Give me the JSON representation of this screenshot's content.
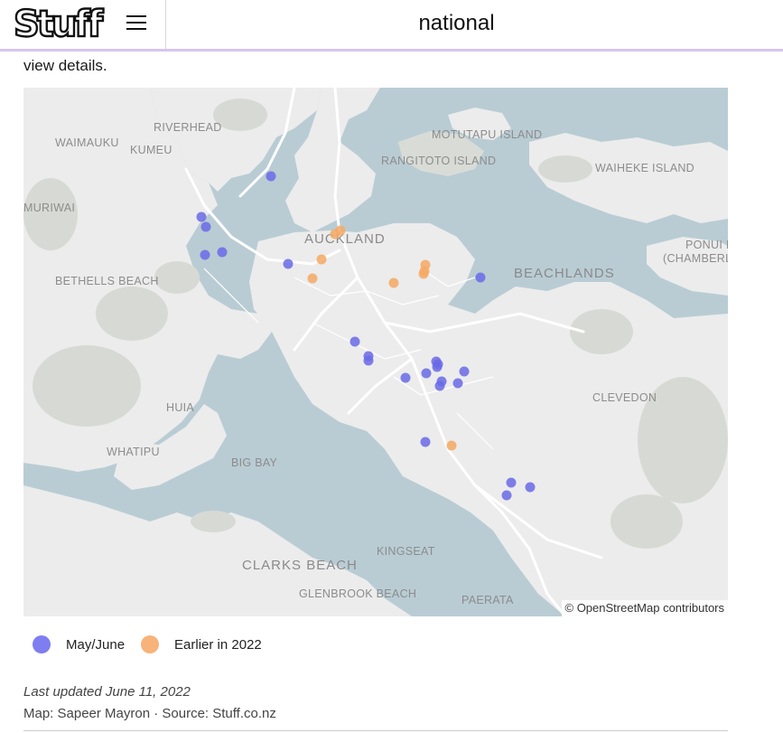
{
  "header": {
    "logo": "Stuff",
    "section": "national"
  },
  "intro_text": "view details.",
  "map": {
    "attribution": "© OpenStreetMap contributors",
    "colors": {
      "water": "#b9ccd4",
      "land": "#f0f0f0",
      "park": "#d6d9d4",
      "road": "#ffffff",
      "may_june": "#6a6ae8",
      "earlier": "#f5a964"
    },
    "place_labels": [
      {
        "id": "riverhead",
        "text": "RIVERHEAD"
      },
      {
        "id": "waimauku",
        "text": "WAIMAUKU"
      },
      {
        "id": "kumeu",
        "text": "KUMEU"
      },
      {
        "id": "motutapu",
        "text": "MOTUTAPU ISLAND"
      },
      {
        "id": "rangitoto",
        "text": "RANGITOTO ISLAND"
      },
      {
        "id": "waiheke",
        "text": "WAIHEKE ISLAND"
      },
      {
        "id": "muriwai",
        "text": "MURIWAI"
      },
      {
        "id": "auckland",
        "text": "AUCKLAND"
      },
      {
        "id": "ponui1",
        "text": "PONUI IS"
      },
      {
        "id": "ponui2",
        "text": "(CHAMBERLIN"
      },
      {
        "id": "beachlands",
        "text": "BEACHLANDS"
      },
      {
        "id": "bethells",
        "text": "BETHELLS BEACH"
      },
      {
        "id": "clevedon",
        "text": "CLEVEDON"
      },
      {
        "id": "huia",
        "text": "HUIA"
      },
      {
        "id": "whatipu",
        "text": "WHATIPU"
      },
      {
        "id": "bigbay",
        "text": "BIG BAY"
      },
      {
        "id": "kingseat",
        "text": "KINGSEAT"
      },
      {
        "id": "clarks",
        "text": "CLARKS BEACH"
      },
      {
        "id": "glenbrook",
        "text": "GLENBROOK BEACH"
      },
      {
        "id": "paerata",
        "text": "PAERATA"
      }
    ],
    "markers": [
      {
        "group": "may_june"
      },
      {
        "group": "may_june"
      },
      {
        "group": "may_june"
      },
      {
        "group": "may_june"
      },
      {
        "group": "may_june"
      },
      {
        "group": "may_june"
      },
      {
        "group": "may_june"
      },
      {
        "group": "may_june"
      },
      {
        "group": "may_june"
      },
      {
        "group": "may_june"
      },
      {
        "group": "may_june"
      },
      {
        "group": "may_june"
      },
      {
        "group": "may_june"
      },
      {
        "group": "may_june"
      },
      {
        "group": "may_june"
      },
      {
        "group": "may_june"
      },
      {
        "group": "may_june"
      },
      {
        "group": "may_june"
      },
      {
        "group": "may_june"
      },
      {
        "group": "may_june"
      },
      {
        "group": "may_june"
      },
      {
        "group": "may_june"
      },
      {
        "group": "may_june"
      },
      {
        "group": "earlier"
      },
      {
        "group": "earlier"
      },
      {
        "group": "earlier"
      },
      {
        "group": "earlier"
      },
      {
        "group": "earlier"
      },
      {
        "group": "earlier"
      },
      {
        "group": "earlier"
      },
      {
        "group": "earlier"
      },
      {
        "group": "earlier"
      }
    ]
  },
  "legend": {
    "may_june": "May/June",
    "earlier": "Earlier in 2022"
  },
  "footer": {
    "updated": "Last updated June 11, 2022",
    "credits": "Map: Sapeer Mayron · Source: Stuff.co.nz"
  }
}
